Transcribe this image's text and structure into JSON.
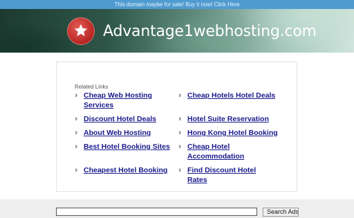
{
  "top_notice": "This domain maybe for sale! Buy it now! Click Here",
  "banner": {
    "site_name": "Advantage1webhosting.com",
    "logo_icon": "star-icon",
    "colors": {
      "logo_red": "#c62b27",
      "top_bar": "#4f9bd0"
    }
  },
  "related": {
    "title": "Related Links",
    "left": [
      {
        "line1": "Cheap Web Hosting",
        "line2": "Services"
      },
      {
        "line1": "Discount Hotel Deals",
        "line2": ""
      },
      {
        "line1": "About Web Hosting",
        "line2": ""
      },
      {
        "line1": "Best Hotel Booking Sites",
        "line2": ""
      },
      {
        "line1": "Cheapest Hotel Booking",
        "line2": ""
      }
    ],
    "right": [
      {
        "line1": "Cheap Hotels Hotel Deals",
        "line2": ""
      },
      {
        "line1": "Hotel Suite Reservation",
        "line2": ""
      },
      {
        "line1": "Hong Kong Hotel Booking",
        "line2": ""
      },
      {
        "line1": "Cheap Hotel",
        "line2": "Accommodation"
      },
      {
        "line1": "Find Discount Hotel",
        "line2": "Rates"
      }
    ],
    "chevron_icon": "double-chevron-right-icon",
    "link_color": "#1a1a8c"
  },
  "search": {
    "value": "",
    "button_label": "Search Ads"
  }
}
